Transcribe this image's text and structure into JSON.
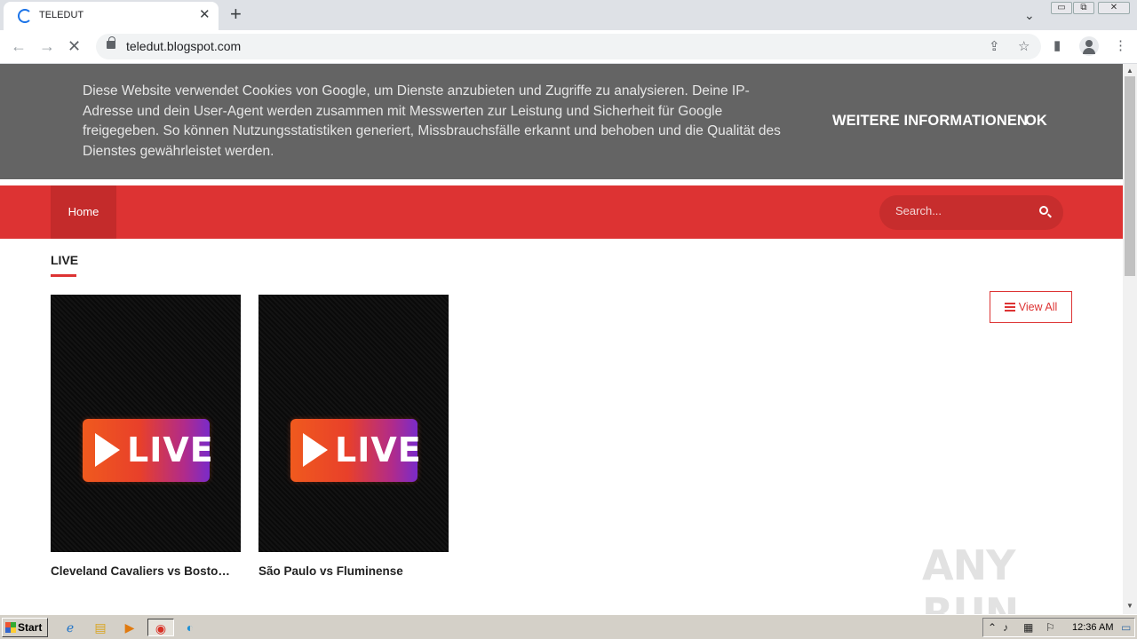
{
  "browser": {
    "tab_title": "TELEDUT",
    "tab_close": "✕",
    "new_tab": "+",
    "url": "teledut.blogspot.com",
    "win_minimize": "▭",
    "win_restore": "⧉",
    "win_close": "✕"
  },
  "cookie_notice": {
    "text": "Diese Website verwendet Cookies von Google, um Dienste anzubieten und Zugriffe zu analysieren. Deine IP-Adresse und dein User-Agent werden zusammen mit Messwerten zur Leistung und Sicherheit für Google freigegeben. So können Nutzungsstatistiken generiert, Missbrauchsfälle erkannt und behoben und die Qualität des Dienstes gewährleistet werden.",
    "more_info": "WEITERE INFORMATIONEN",
    "ok": "OK"
  },
  "nav": {
    "home": "Home",
    "search_placeholder": "Search..."
  },
  "section": {
    "title": "LIVE",
    "view_all": "View All"
  },
  "posts": [
    {
      "title": "Cleveland Cavaliers vs Boston Celtics",
      "badge": "LIVE"
    },
    {
      "title": "São Paulo vs Fluminense",
      "badge": "LIVE"
    }
  ],
  "watermark": "ANY RUN",
  "taskbar": {
    "start": "Start",
    "clock": "12:36 AM"
  }
}
